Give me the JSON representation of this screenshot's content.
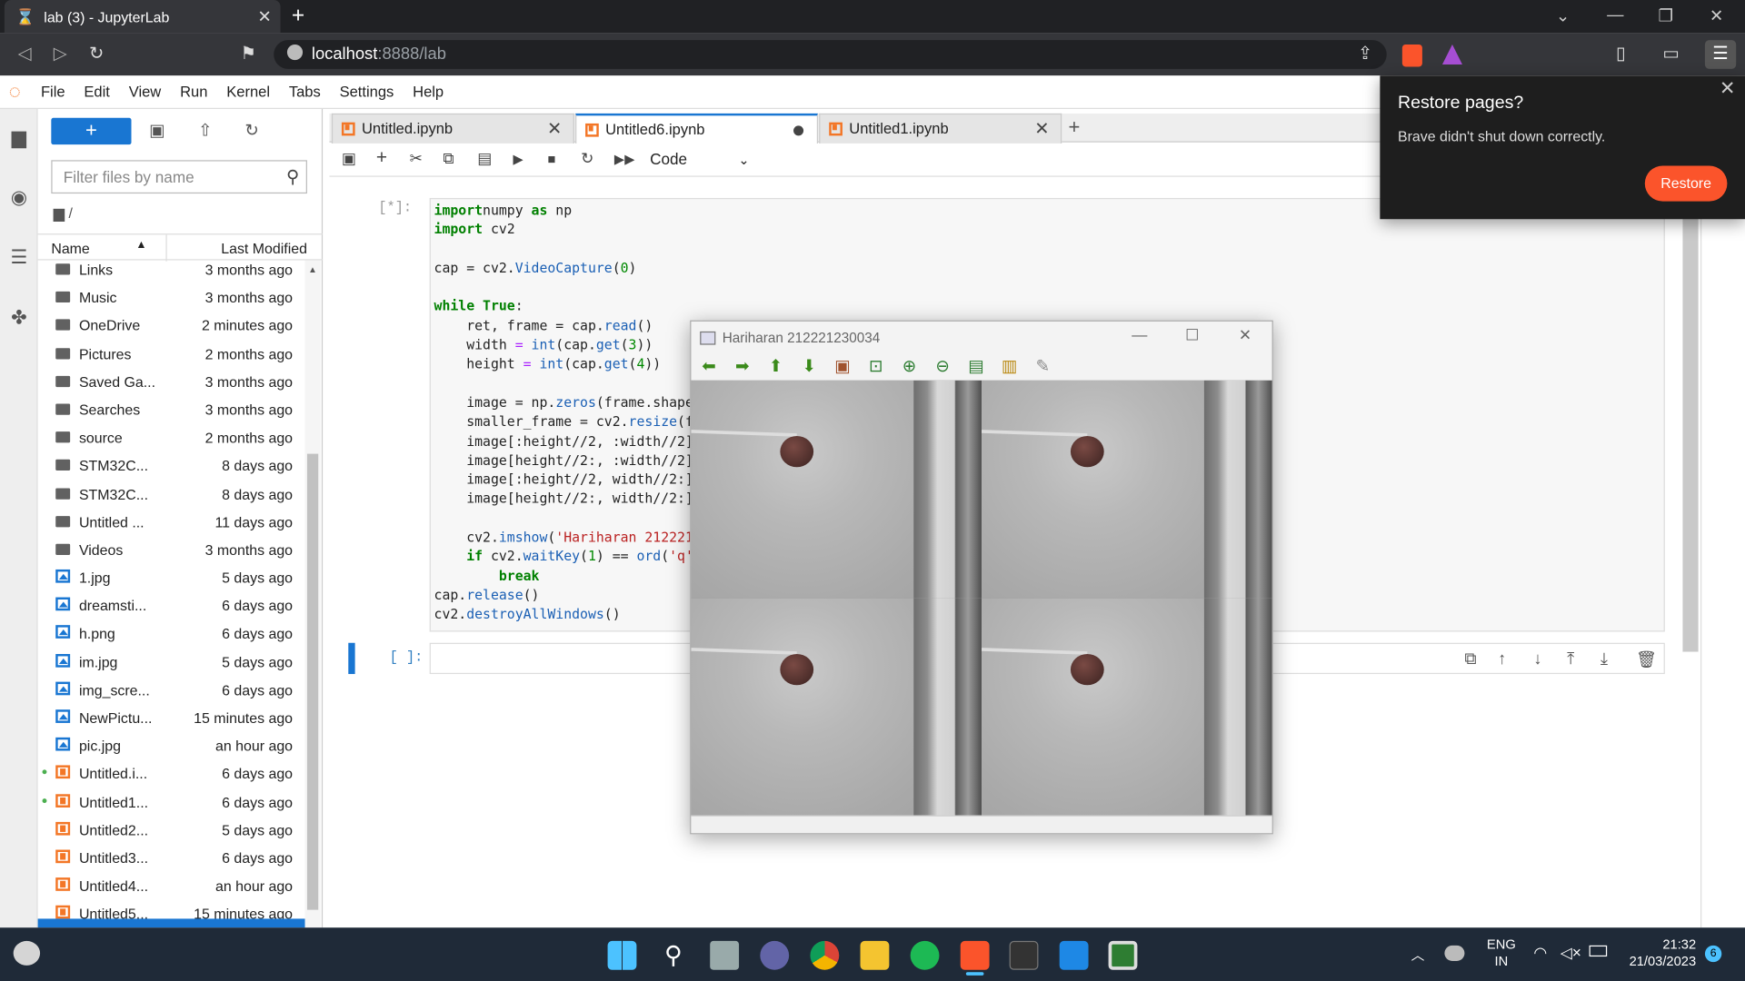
{
  "browser": {
    "tab_title": "lab (3) - JupyterLab",
    "tab_close": "✕",
    "new_tab": "+",
    "url_host": "localhost",
    "url_rest": ":8888/lab"
  },
  "menu": [
    "File",
    "Edit",
    "View",
    "Run",
    "Kernel",
    "Tabs",
    "Settings",
    "Help"
  ],
  "filebrowser": {
    "new_button": "+",
    "filter_placeholder": "Filter files by name",
    "breadcrumb": "/",
    "col_name": "Name",
    "col_modified": "Last Modified",
    "files": [
      {
        "name": "Links",
        "time": "3 months ago",
        "kind": "folder"
      },
      {
        "name": "Music",
        "time": "3 months ago",
        "kind": "folder"
      },
      {
        "name": "OneDrive",
        "time": "2 minutes ago",
        "kind": "folder"
      },
      {
        "name": "Pictures",
        "time": "2 months ago",
        "kind": "folder"
      },
      {
        "name": "Saved Ga...",
        "time": "3 months ago",
        "kind": "folder"
      },
      {
        "name": "Searches",
        "time": "3 months ago",
        "kind": "folder"
      },
      {
        "name": "source",
        "time": "2 months ago",
        "kind": "folder"
      },
      {
        "name": "STM32C...",
        "time": "8 days ago",
        "kind": "folder"
      },
      {
        "name": "STM32C...",
        "time": "8 days ago",
        "kind": "folder"
      },
      {
        "name": "Untitled ...",
        "time": "11 days ago",
        "kind": "folder"
      },
      {
        "name": "Videos",
        "time": "3 months ago",
        "kind": "folder"
      },
      {
        "name": "1.jpg",
        "time": "5 days ago",
        "kind": "image"
      },
      {
        "name": "dreamsti...",
        "time": "6 days ago",
        "kind": "image"
      },
      {
        "name": "h.png",
        "time": "6 days ago",
        "kind": "image"
      },
      {
        "name": "im.jpg",
        "time": "5 days ago",
        "kind": "image"
      },
      {
        "name": "img_scre...",
        "time": "6 days ago",
        "kind": "image"
      },
      {
        "name": "NewPictu...",
        "time": "15 minutes ago",
        "kind": "image"
      },
      {
        "name": "pic.jpg",
        "time": "an hour ago",
        "kind": "image"
      },
      {
        "name": "Untitled.i...",
        "time": "6 days ago",
        "kind": "notebook",
        "running": true
      },
      {
        "name": "Untitled1...",
        "time": "6 days ago",
        "kind": "notebook",
        "running": true
      },
      {
        "name": "Untitled2...",
        "time": "5 days ago",
        "kind": "notebook"
      },
      {
        "name": "Untitled3...",
        "time": "6 days ago",
        "kind": "notebook"
      },
      {
        "name": "Untitled4...",
        "time": "an hour ago",
        "kind": "notebook"
      },
      {
        "name": "Untitled5...",
        "time": "15 minutes ago",
        "kind": "notebook"
      }
    ]
  },
  "notebook_tabs": [
    {
      "label": "Untitled.ipynb",
      "state": "close"
    },
    {
      "label": "Untitled6.ipynb",
      "state": "dirty"
    },
    {
      "label": "Untitled1.ipynb",
      "state": "close"
    }
  ],
  "toolbar": {
    "cell_type": "Code"
  },
  "cells": {
    "prompt1": "[*]:",
    "prompt2": "[ ]:"
  },
  "code_lines": [
    [
      [
        "kw",
        "import"
      ],
      [
        "",
        "numpy "
      ],
      [
        "kw",
        "as"
      ],
      [
        "",
        " np"
      ]
    ],
    [
      [
        "kw",
        "import"
      ],
      [
        "",
        " cv2"
      ]
    ],
    [],
    [
      [
        "",
        "cap = cv2."
      ],
      [
        "fn",
        "VideoCapture"
      ],
      [
        "",
        "("
      ],
      [
        "nu",
        "0"
      ],
      [
        "",
        ")"
      ]
    ],
    [],
    [
      [
        "kw",
        "while"
      ],
      [
        "",
        ""
      ],
      [
        "kw",
        " True"
      ],
      [
        "",
        ":"
      ]
    ],
    [
      [
        "",
        "    ret, frame = cap."
      ],
      [
        "fn",
        "read"
      ],
      [
        "",
        "()"
      ]
    ],
    [
      [
        "",
        "    width "
      ],
      [
        "op",
        "="
      ],
      [
        "",
        " "
      ],
      [
        "fn",
        "int"
      ],
      [
        "",
        "(cap."
      ],
      [
        "fn",
        "get"
      ],
      [
        "",
        "("
      ],
      [
        "nu",
        "3"
      ],
      [
        "",
        "))"
      ]
    ],
    [
      [
        "",
        "    height "
      ],
      [
        "op",
        "="
      ],
      [
        "",
        " "
      ],
      [
        "fn",
        "int"
      ],
      [
        "",
        "(cap."
      ],
      [
        "fn",
        "get"
      ],
      [
        "",
        "("
      ],
      [
        "nu",
        "4"
      ],
      [
        "",
        "))"
      ]
    ],
    [],
    [
      [
        "",
        "    image = np."
      ],
      [
        "fn",
        "zeros"
      ],
      [
        "",
        "(frame.shape"
      ]
    ],
    [
      [
        "",
        "    smaller_frame = cv2."
      ],
      [
        "fn",
        "resize"
      ],
      [
        "",
        "(f"
      ]
    ],
    [
      [
        "",
        "    image[:height//2, :width//2]"
      ]
    ],
    [
      [
        "",
        "    image[height//2:, :width//2]"
      ]
    ],
    [
      [
        "",
        "    image[:height//2, width//2:]"
      ]
    ],
    [
      [
        "",
        "    image[height//2:, width//2:]"
      ]
    ],
    [],
    [
      [
        "",
        "    cv2."
      ],
      [
        "fn",
        "imshow"
      ],
      [
        "",
        "("
      ],
      [
        "st",
        "'Hariharan 212221"
      ]
    ],
    [
      [
        "kw",
        "    if"
      ],
      [
        "",
        " cv2."
      ],
      [
        "fn",
        "waitKey"
      ],
      [
        "",
        "("
      ],
      [
        "nu",
        "1"
      ],
      [
        "",
        ") == "
      ],
      [
        "fn",
        "ord"
      ],
      [
        "",
        "("
      ],
      [
        "st",
        "'q'"
      ]
    ],
    [
      [
        "kw",
        "        break"
      ]
    ],
    [
      [
        "",
        "cap."
      ],
      [
        "fn",
        "release"
      ],
      [
        "",
        "()"
      ]
    ],
    [
      [
        "",
        "cv2."
      ],
      [
        "fn",
        "destroyAllWindows"
      ],
      [
        "",
        "()"
      ]
    ]
  ],
  "cv_window": {
    "title": "Hariharan 212221230034",
    "tools": [
      "arrow-left",
      "arrow-right",
      "arrow-up",
      "arrow-down",
      "image",
      "zoom-fit",
      "zoom-in",
      "zoom-out",
      "save",
      "copy",
      "brush"
    ]
  },
  "restore_popup": {
    "title": "Restore pages?",
    "body": "Brave didn't shut down correctly.",
    "button": "Restore"
  },
  "tray": {
    "lang1": "ENG",
    "lang2": "IN",
    "time": "21:32",
    "date": "21/03/2023",
    "badge": "6"
  }
}
